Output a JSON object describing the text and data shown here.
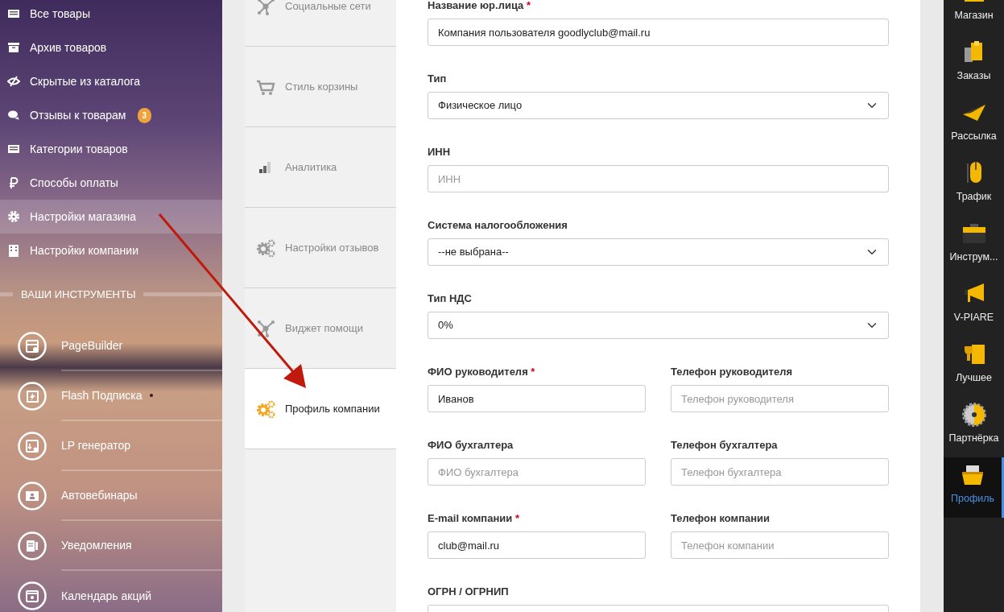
{
  "sidebar": {
    "items": [
      {
        "label": "Все товары",
        "selected": false
      },
      {
        "label": "Архив товаров",
        "selected": false
      },
      {
        "label": "Скрытые из каталога",
        "selected": false
      },
      {
        "label": "Отзывы к товарам",
        "badge": "3",
        "selected": false
      },
      {
        "label": "Категории товаров",
        "selected": false
      },
      {
        "label": "Способы оплаты",
        "selected": false
      },
      {
        "label": "Настройки магазина",
        "selected": true
      },
      {
        "label": "Настройки компании",
        "selected": false
      }
    ],
    "section_title": "ВАШИ ИНСТРУМЕНТЫ",
    "tools": [
      {
        "label": "PageBuilder",
        "new_dot": false
      },
      {
        "label": "Flash Подписка",
        "new_dot": true
      },
      {
        "label": "LP генератор",
        "new_dot": false
      },
      {
        "label": "Автовебинары",
        "new_dot": false
      },
      {
        "label": "Уведомления",
        "new_dot": false
      },
      {
        "label": "Календарь акций",
        "new_dot": false
      }
    ]
  },
  "settings_tabs": [
    {
      "label": "Социальные сети",
      "selected": false
    },
    {
      "label": "Стиль корзины",
      "selected": false
    },
    {
      "label": "Аналитика",
      "selected": false
    },
    {
      "label": "Настройки отзывов",
      "selected": false
    },
    {
      "label": "Виджет помощи",
      "selected": false
    },
    {
      "label": "Профиль компании",
      "selected": true
    }
  ],
  "form": {
    "rows": [
      [
        {
          "label": "Название юр.лица",
          "required_mark": "*",
          "kind": "input",
          "value": "Компания пользователя goodlyclub@mail.ru"
        }
      ],
      [
        {
          "label": "Тип",
          "kind": "select",
          "value": "Физическое лицо"
        }
      ],
      [
        {
          "label": "ИНН",
          "kind": "input",
          "placeholder": "ИНН"
        }
      ],
      [
        {
          "label": "Система налогообложения",
          "kind": "select",
          "value": "--не выбрана--"
        }
      ],
      [
        {
          "label": "Тип НДС",
          "kind": "select",
          "value": "0%"
        }
      ],
      [
        {
          "label": "ФИО руководителя",
          "required_mark": "*",
          "kind": "input",
          "value": "Иванов"
        },
        {
          "label": "Телефон руководителя",
          "kind": "input",
          "placeholder": "Телефон руководителя"
        }
      ],
      [
        {
          "label": "ФИО бухгалтера",
          "kind": "input",
          "placeholder": "ФИО бухгалтера"
        },
        {
          "label": "Телефон бухгалтера",
          "kind": "input",
          "placeholder": "Телефон бухгалтера"
        }
      ],
      [
        {
          "label": "E-mail компании",
          "required_mark": "*",
          "kind": "input",
          "value": "club@mail.ru"
        },
        {
          "label": "Телефон компании",
          "kind": "input",
          "placeholder": "Телефон компании"
        }
      ],
      [
        {
          "label": "ОГРН / ОГРНИП",
          "kind": "input"
        }
      ]
    ]
  },
  "app_bar": {
    "items": [
      {
        "label": "Магазин",
        "selected": false
      },
      {
        "label": "Заказы",
        "selected": false
      },
      {
        "label": "Рассылка",
        "selected": false
      },
      {
        "label": "Трафик",
        "selected": false
      },
      {
        "label": "Инструм...",
        "selected": false
      },
      {
        "label": "V-PIARE",
        "selected": false
      },
      {
        "label": "Лучшее",
        "selected": false
      },
      {
        "label": "Партнёрка",
        "selected": false
      },
      {
        "label": "Профиль",
        "selected": true
      }
    ]
  }
}
